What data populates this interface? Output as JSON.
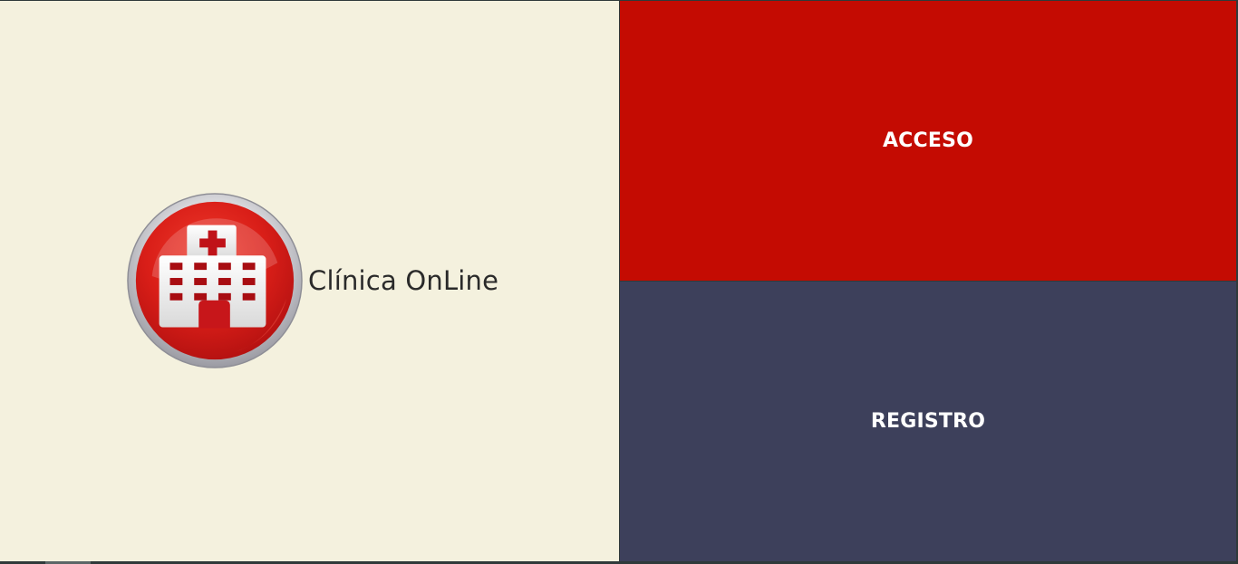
{
  "brand": {
    "name": "Clínica OnLine",
    "logo_icon": "hospital-icon",
    "logo_color": "#d91e18"
  },
  "actions": {
    "login_label": "ACCESO",
    "register_label": "REGISTRO"
  },
  "colors": {
    "left_background": "#f4f1de",
    "login_background": "#c40b02",
    "register_background": "#3d405b",
    "text_on_tiles": "#ffffff"
  }
}
